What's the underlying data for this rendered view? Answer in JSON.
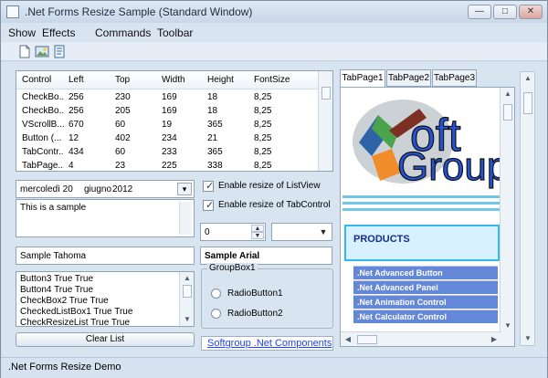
{
  "window": {
    "title": ".Net Forms Resize Sample (Standard Window)",
    "buttons": {
      "minimize": "—",
      "maximize": "□",
      "close": "✕"
    }
  },
  "menu": [
    "Show",
    "Effects",
    "Commands",
    "Toolbar"
  ],
  "toolbar": {
    "icons": [
      "new-document-icon",
      "image-icon",
      "document-text-icon"
    ]
  },
  "listview": {
    "headers": [
      "Control",
      "Left",
      "Top",
      "Width",
      "Height",
      "FontSize"
    ],
    "rows": [
      [
        "CheckBo...",
        "256",
        "230",
        "169",
        "18",
        "8,25"
      ],
      [
        "CheckBo...",
        "256",
        "205",
        "169",
        "18",
        "8,25"
      ],
      [
        "VScrollB...",
        "670",
        "60",
        "19",
        "365",
        "8,25"
      ],
      [
        "Button (...",
        "12",
        "402",
        "234",
        "21",
        "8,25"
      ],
      [
        "TabContr...",
        "434",
        "60",
        "233",
        "365",
        "8,25"
      ],
      [
        "TabPage...",
        "4",
        "23",
        "225",
        "338",
        "8,25"
      ]
    ]
  },
  "date": {
    "day": "mercoledì 20",
    "month": "giugno",
    "year": "2012",
    "calendar_icon": "calendar-icon"
  },
  "textarea": {
    "value": "This is a sample"
  },
  "checkboxes": {
    "listview": "Enable resize of ListView",
    "tabcontrol": "Enable resize of TabControl"
  },
  "numeric": {
    "value": "0"
  },
  "combo": {
    "value": ""
  },
  "sample_tahoma": "Sample Tahoma",
  "sample_arial": "Sample Arial",
  "listbox": [
    "Button3 True True",
    "Button4 True True",
    "CheckBox2 True True",
    "CheckedListBox1 True True",
    "CheckResizeList True True"
  ],
  "clear_button": "Clear List",
  "groupbox": {
    "title": "GroupBox1",
    "radio1": "RadioButton1",
    "radio2": "RadioButton2"
  },
  "link": "Softgroup .Net Components",
  "tabs": {
    "labels": [
      "TabPage1",
      "TabPage2",
      "TabPage3"
    ],
    "logo": {
      "line1": "oft",
      "line2": "Group"
    },
    "products_title": "PRODUCTS",
    "products": [
      ".Net Advanced Button",
      ".Net Advanced Panel",
      ".Net Animation Control",
      ".Net Calculator Control"
    ]
  },
  "status": ".Net Forms Resize Demo"
}
